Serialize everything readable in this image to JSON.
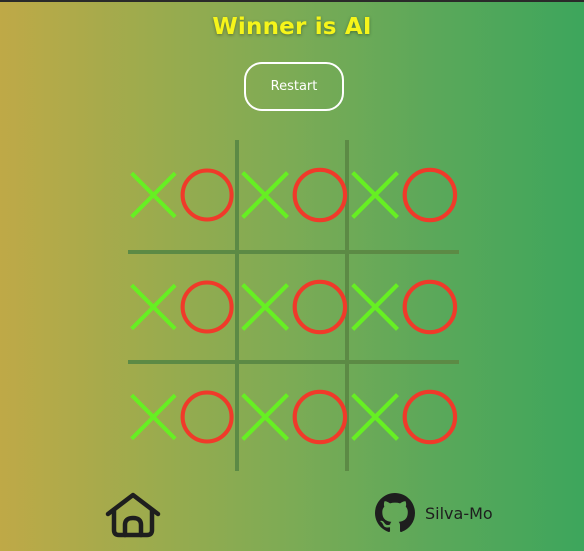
{
  "status": {
    "text": "Winner is AI"
  },
  "controls": {
    "restart_label": "Restart"
  },
  "board": {
    "cells": [
      "X",
      "O",
      "X",
      "",
      "O",
      "X",
      "",
      "O",
      ""
    ]
  },
  "footer": {
    "home_icon": "home-icon",
    "github_icon": "github-icon",
    "github_label": "Silva-Mo"
  },
  "colors": {
    "x_mark": "#66f022",
    "o_mark": "#f03a2a",
    "status_text": "#f6f51a",
    "grid_line": "#5c8a45",
    "gradient_start": "#bfa947",
    "gradient_end": "#3da65c"
  }
}
